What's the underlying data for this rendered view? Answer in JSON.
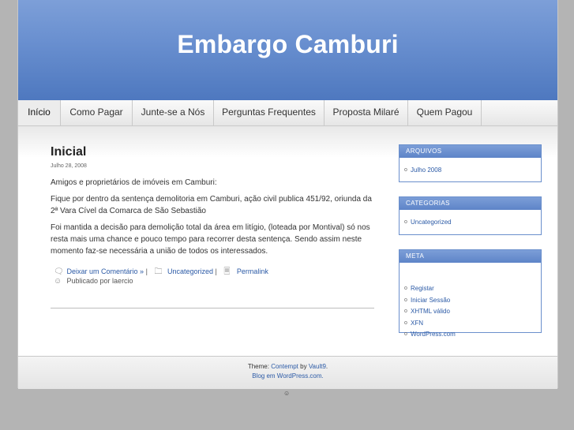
{
  "site": {
    "title": "Embargo Camburi"
  },
  "nav": {
    "items": [
      {
        "label": "Início"
      },
      {
        "label": "Como Pagar"
      },
      {
        "label": "Junte-se a Nós"
      },
      {
        "label": "Perguntas Frequentes"
      },
      {
        "label": "Proposta Milaré"
      },
      {
        "label": "Quem Pagou"
      }
    ]
  },
  "post": {
    "title": "Inicial",
    "date": "Julho 28, 2008",
    "paragraphs": [
      "Amigos e proprietários de imóveis em Camburi:",
      "Fique por dentro da sentença demolitoria em Camburi, ação civil publica 451/92, oriunda da 2ª Vara Cível da Comarca de São Sebastião",
      "Foi mantida a decisão para demolição total da área em litígio, (loteada por Montival) só nos resta mais uma chance e pouco tempo para recorrer desta sentença. Sendo assim neste momento faz-se necessária a união de todos os interessados."
    ],
    "meta": {
      "comment_link": "Deixar um Comentário »",
      "separator": "|",
      "category": "Uncategorized",
      "permalink": "Permalink",
      "author": "Publicado por laercio"
    }
  },
  "sidebar": {
    "archives": {
      "title": "ARQUIVOS",
      "items": [
        "Julho 2008"
      ]
    },
    "categories": {
      "title": "CATEGORIAS",
      "items": [
        "Uncategorized"
      ]
    },
    "meta": {
      "title": "META",
      "items": [
        "Registar",
        "Iniciar Sessão",
        "XHTML válido",
        "XFN",
        "WordPress.com"
      ]
    }
  },
  "footer": {
    "theme_prefix": "Theme:",
    "theme_name": "Contempt",
    "by": "by",
    "author": "Vault9",
    "period": ".",
    "blog_line": "Blog em WordPress.com."
  },
  "icons": {
    "comment": "comment-icon",
    "category": "folder-icon",
    "permalink": "link-icon",
    "author": "user-icon",
    "footer": "smiley-icon"
  },
  "colors": {
    "header_blue": "#5f86c8",
    "link": "#2b5aa6",
    "widget_blue": "#6a8fcc"
  }
}
